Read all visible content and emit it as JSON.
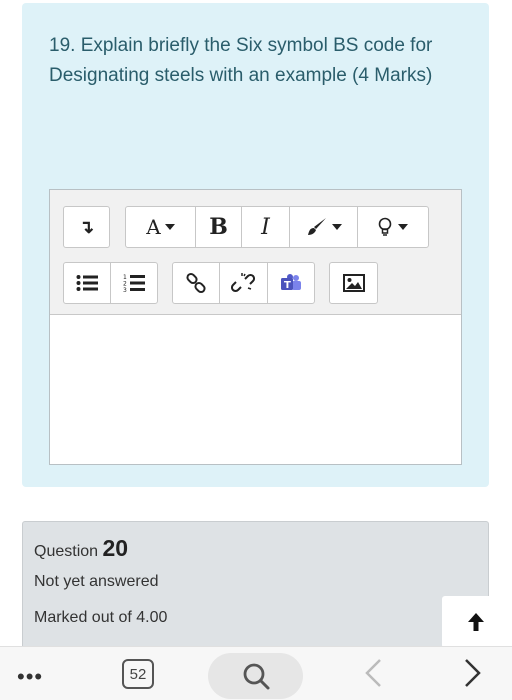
{
  "question19": {
    "text": "19. Explain briefly the Six symbol BS code for Designating steels with an example (4 Marks)"
  },
  "editor": {
    "toolbar_row1": [
      {
        "icon": "collapse-toolbar-icon",
        "label": "↴"
      },
      {
        "icon": "font-style-dropdown",
        "label": "A"
      },
      {
        "icon": "bold-icon",
        "label": "B"
      },
      {
        "icon": "italic-icon",
        "label": "I"
      },
      {
        "icon": "text-color-brush-icon",
        "label": ""
      },
      {
        "icon": "lightbulb-dropdown-icon",
        "label": ""
      }
    ],
    "toolbar_row2": [
      {
        "icon": "bullet-list-icon"
      },
      {
        "icon": "numbered-list-icon"
      },
      {
        "icon": "link-icon"
      },
      {
        "icon": "unlink-icon"
      },
      {
        "icon": "teams-meeting-icon"
      },
      {
        "icon": "image-icon"
      }
    ],
    "content": ""
  },
  "question20": {
    "label": "Question",
    "number": "20",
    "status": "Not yet answered",
    "marked_out_of": "Marked out of 4.00"
  },
  "browser_bar": {
    "tab_count": "52",
    "menu_dots": "•••"
  },
  "colors": {
    "question_bg": "#def2f8",
    "question_text": "#2a5d6b",
    "info_bg": "#dee2e5",
    "teams_purple": "#5059c9"
  }
}
